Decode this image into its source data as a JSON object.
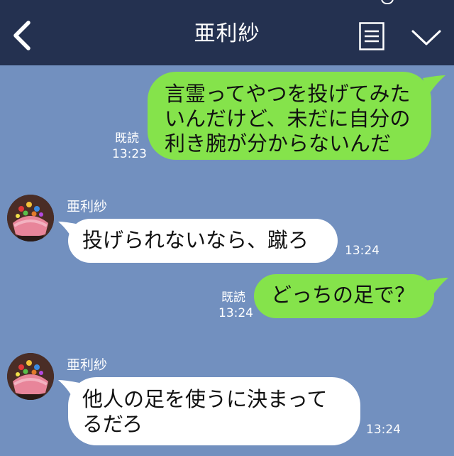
{
  "header": {
    "title": "亜利紗"
  },
  "messages": [
    {
      "direction": "outgoing",
      "text": "言霊ってやつを投げてみた\nいんだけど、未だに自分の\n利き腕が分からないんだ",
      "read_label": "既読",
      "time": "13:23"
    },
    {
      "direction": "incoming",
      "sender": "亜利紗",
      "text": "投げられないなら、蹴ろ",
      "time": "13:24"
    },
    {
      "direction": "outgoing",
      "text": "どっちの足で？",
      "read_label": "既読",
      "time": "13:24"
    },
    {
      "direction": "incoming",
      "sender": "亜利紗",
      "text": "他人の足を使うに決まって\nるだろ",
      "time": "13:24"
    }
  ],
  "colors": {
    "header_bg": "#243150",
    "chat_bg": "#7290bf",
    "outgoing_bubble": "#85e34b",
    "incoming_bubble": "#ffffff"
  },
  "icons": {
    "back": "chevron-left-icon",
    "menu": "menu-list-icon",
    "dropdown": "chevron-down-icon",
    "avatar": "cupcake-avatar"
  }
}
